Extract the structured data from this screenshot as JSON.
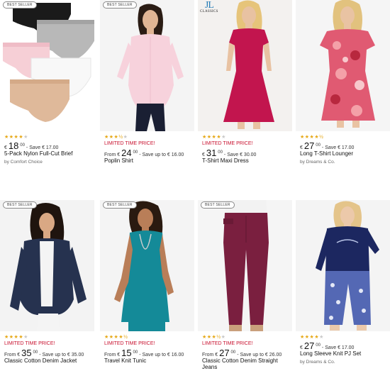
{
  "products": [
    {
      "badge": "BEST SELLER",
      "stars": 4,
      "promo": "",
      "price_prefix": "€",
      "price_main": "18",
      "price_cents": "00",
      "price_save": "- Save € 17.00",
      "name": "5-Pack Nylon Full-Cut Brief",
      "by": "by Comfort Choice",
      "swatches": [
        "#f1f1f1",
        "#d9c0a8",
        "#c8102e",
        "#e36aa0",
        "#3b7dc2",
        "#f5d6e0",
        "#222222",
        "#8b1a3a",
        "#2e2e2e",
        "#8fc1d6",
        "#d8d8d8",
        "#c45a8a",
        "#3a3a8c",
        "#1a1a1a"
      ]
    },
    {
      "badge": "BEST SELLER",
      "stars": 3.5,
      "promo": "LIMITED TIME PRICE!",
      "price_prefix": "From €",
      "price_main": "24",
      "price_cents": "00",
      "price_save": "- Save up to € 16.00",
      "name": "Poplin Shirt",
      "by": "",
      "swatches": [
        "#f7c7d4",
        "#e0e8f0",
        "#f2f2f2",
        "#d8c49a",
        "#8fb4d8",
        "#e2b04a",
        "#5a7fb8",
        "#c4281f",
        "#e25a8c",
        "#7fbcd6",
        "#2a5a8a",
        "#b4b4b4",
        "#6b3a8c",
        "#1f1f1f"
      ]
    },
    {
      "badge": "",
      "logo_top": "JL",
      "logo_bottom": "CLASSICS",
      "stars": 4,
      "promo": "LIMITED TIME PRICE!",
      "price_prefix": "€",
      "price_main": "31",
      "price_cents": "00",
      "price_save": "- Save € 30.00",
      "name": "T-Shirt Maxi Dress",
      "by": "",
      "swatches": [
        "#1f2a5a",
        "#c8174f",
        "#2a2a2a",
        "#d8d8d8",
        "#f2d030",
        "#1c8a8a",
        "#6a2a8a",
        "#0f0f0f"
      ]
    },
    {
      "badge": "",
      "stars": 4.5,
      "promo": "",
      "price_prefix": "€",
      "price_main": "27",
      "price_cents": "00",
      "price_save": "- Save € 17.00",
      "name": "Long T-Shirt Lounger",
      "by": "by Dreams & Co.",
      "swatches": [
        "#d84a7a",
        "#1c2a6a",
        "#e4e4e4",
        "#c0c0d8",
        "#4a8ac8",
        "#1f1f6a",
        "#e08aa8",
        "#2a5a9a",
        "#8a3a6a",
        "#b4d8e8",
        "#3a3a7a",
        "#c85a9a",
        "#6a8ac0",
        "#2a2a5a",
        "#e8b4c8",
        "#4a6ab8"
      ]
    },
    {
      "badge": "BEST SELLER",
      "stars": 4,
      "promo": "LIMITED TIME PRICE!",
      "price_prefix": "From €",
      "price_main": "35",
      "price_cents": "00",
      "price_save": "- Save up to € 35.00",
      "name": "Classic Cotton Denim Jacket",
      "by": "",
      "swatches": [
        "#2a3a5a",
        "#c4102e",
        "#8a5a3a",
        "#1c2a4a",
        "#5a8ac8",
        "#0f0f0f",
        "#d8c49a",
        "#f2f2f2",
        "#3a3a3a",
        "#b4b4b4",
        "#6a4a2a",
        "#8fb4d8",
        "#f2f2f2"
      ]
    },
    {
      "badge": "BEST SELLER",
      "stars": 4.5,
      "promo": "LIMITED TIME PRICE!",
      "price_prefix": "From €",
      "price_main": "15",
      "price_cents": "00",
      "price_save": "- Save up to € 16.00",
      "name": "Travel Knit Tunic",
      "by": "",
      "swatches": [
        "#c9a15a",
        "#3a2a1a",
        "#7a6a5a",
        "#c4102e",
        "#2a2a2a",
        "#f2f2f2",
        "#1c8a9a",
        "#4a4a4a",
        "#2a2a6a",
        "#0f0f0f"
      ]
    },
    {
      "badge": "BEST SELLER",
      "stars": 3.5,
      "promo": "LIMITED TIME PRICE!",
      "price_prefix": "From €",
      "price_main": "27",
      "price_cents": "00",
      "price_save": "- Save up to € 26.00",
      "name": "Classic Cotton Denim Straight Jeans",
      "by": "",
      "swatches": [
        "#2a3a6a",
        "#e4e4e4",
        "#c4102e",
        "#5a5a8a",
        "#1f2a4a",
        "#6a1a3a",
        "#3a4a7a",
        "#b4b4b4",
        "#0f0f0f",
        "#8fb4d8",
        "#1c1c2a",
        "#d8d8d8"
      ]
    },
    {
      "badge": "",
      "stars": 4,
      "promo": "",
      "price_prefix": "€",
      "price_main": "27",
      "price_cents": "00",
      "price_save": "- Save € 17.00",
      "name": "Long Sleeve Knit PJ Set",
      "by": "by Dreams & Co.",
      "swatches": [
        "#1c2a6a",
        "#d84a7a",
        "#3a3a3a",
        "#e4e4e4",
        "#4a6ab8",
        "#8a1a3a",
        "#c0c0d8",
        "#2a2a5a",
        "#6a8ac0",
        "#b4d8e8",
        "#e08aa8",
        "#3a5a9a",
        "#1f1f4a",
        "#c85a9a"
      ]
    }
  ]
}
